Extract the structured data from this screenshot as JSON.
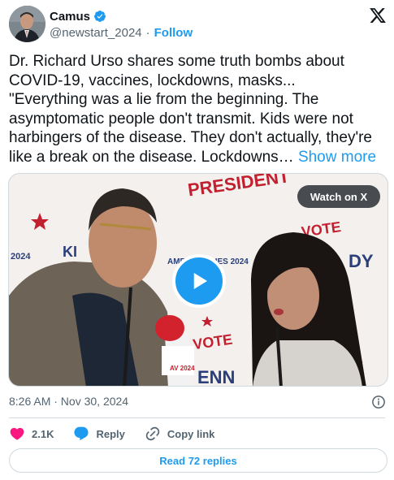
{
  "author": {
    "display_name": "Camus",
    "handle": "@newstart_2024",
    "separator": "·",
    "follow_label": "Follow"
  },
  "tweet": {
    "text_lines": [
      "Dr. Richard Urso shares some truth bombs about",
      "COVID-19, vaccines, lockdowns, masks...",
      "\"Everything was a lie from the beginning. The",
      "asymptomatic people don't transmit. Kids were not",
      "harbingers of the disease. They don't actually, they're",
      "like a break on the disease. Lockdowns… "
    ],
    "show_more_label": "Show more"
  },
  "media": {
    "watch_label": "Watch on X",
    "backdrop_text": {
      "president": "PRESIDENT",
      "vote1": "VOTE",
      "vote2": "VOTE",
      "year_left": "2024",
      "values": "AMERI    VALUES 2024",
      "dy": "DY",
      "ki": "KI",
      "enn": "ENN",
      "mic": "AV 2024"
    }
  },
  "meta": {
    "timestamp": "8:26 AM · Nov 30, 2024"
  },
  "actions": {
    "likes": "2.1K",
    "reply_label": "Reply",
    "copy_label": "Copy link"
  },
  "read_replies_label": "Read 72 replies",
  "colors": {
    "accent": "#1d9bf0",
    "like": "#f91880",
    "text": "#0f1419",
    "secondary": "#536471"
  }
}
